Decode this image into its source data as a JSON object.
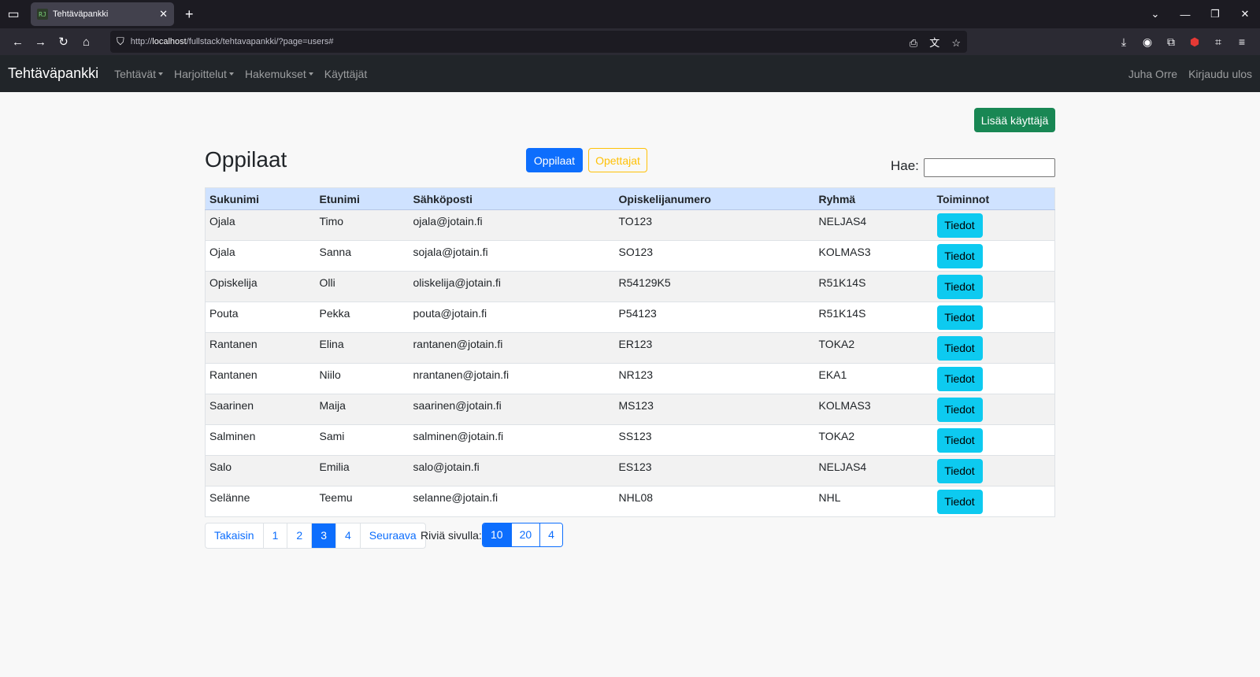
{
  "browser": {
    "tab_title": "Tehtäväpankki",
    "favicon_text": "RJ",
    "url_prefix": "http://",
    "url_host": "localhost",
    "url_path": "/fullstack/tehtavapankki/?page=users#"
  },
  "nav": {
    "brand": "Tehtäväpankki",
    "items": [
      {
        "label": "Tehtävät",
        "dropdown": true
      },
      {
        "label": "Harjoittelut",
        "dropdown": true
      },
      {
        "label": "Hakemukset",
        "dropdown": true
      },
      {
        "label": "Käyttäjät",
        "dropdown": false
      }
    ],
    "user": "Juha Orre",
    "logout": "Kirjaudu ulos"
  },
  "main": {
    "add_user": "Lisää käyttäjä",
    "title": "Oppilaat",
    "toggle_students": "Oppilaat",
    "toggle_teachers": "Opettajat",
    "search_label": "Hae:",
    "columns": [
      "Sukunimi",
      "Etunimi",
      "Sähköposti",
      "Opiskelijanumero",
      "Ryhmä",
      "Toiminnot"
    ],
    "details_label": "Tiedot",
    "rows": [
      [
        "Ojala",
        "Timo",
        "ojala@jotain.fi",
        "TO123",
        "NELJAS4"
      ],
      [
        "Ojala",
        "Sanna",
        "sojala@jotain.fi",
        "SO123",
        "KOLMAS3"
      ],
      [
        "Opiskelija",
        "Olli",
        "oliskelija@jotain.fi",
        "R54129K5",
        "R51K14S"
      ],
      [
        "Pouta",
        "Pekka",
        "pouta@jotain.fi",
        "P54123",
        "R51K14S"
      ],
      [
        "Rantanen",
        "Elina",
        "rantanen@jotain.fi",
        "ER123",
        "TOKA2"
      ],
      [
        "Rantanen",
        "Niilo",
        "nrantanen@jotain.fi",
        "NR123",
        "EKA1"
      ],
      [
        "Saarinen",
        "Maija",
        "saarinen@jotain.fi",
        "MS123",
        "KOLMAS3"
      ],
      [
        "Salminen",
        "Sami",
        "salminen@jotain.fi",
        "SS123",
        "TOKA2"
      ],
      [
        "Salo",
        "Emilia",
        "salo@jotain.fi",
        "ES123",
        "NELJAS4"
      ],
      [
        "Selänne",
        "Teemu",
        "selanne@jotain.fi",
        "NHL08",
        "NHL"
      ]
    ]
  },
  "pagination": {
    "prev": "Takaisin",
    "pages": [
      "1",
      "2",
      "3",
      "4"
    ],
    "active_page": "3",
    "next": "Seuraava",
    "rows_label": "Riviä sivulla:",
    "row_options": [
      "10",
      "20",
      "4"
    ],
    "active_rows": "10"
  },
  "colors": {
    "navbar": "#212529",
    "primary": "#0d6efd",
    "success": "#198754",
    "warning": "#ffc107",
    "info": "#0dcaf0",
    "table_header": "#cfe2ff"
  }
}
